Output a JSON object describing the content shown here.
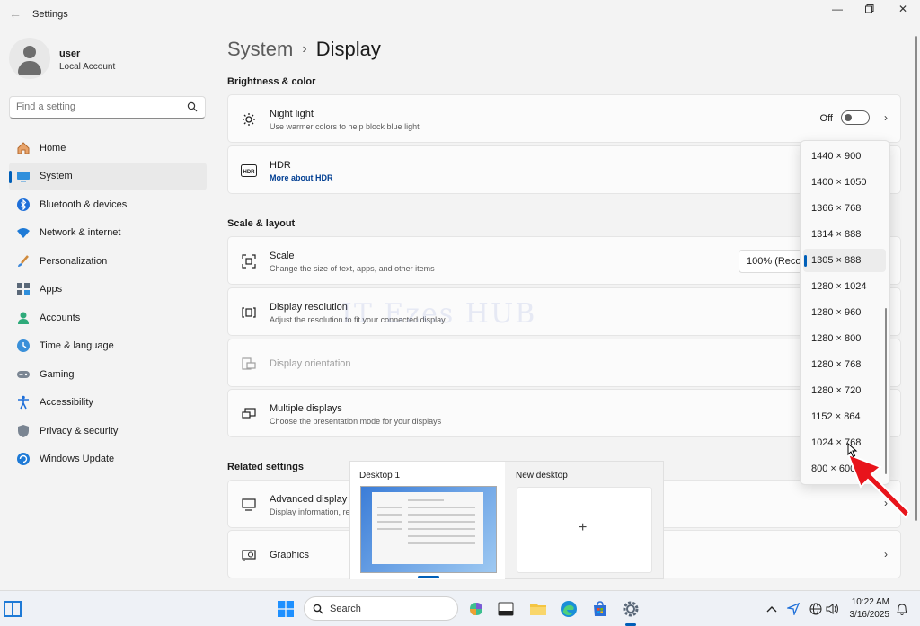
{
  "window": {
    "title": "Settings"
  },
  "profile": {
    "name": "user",
    "account_type": "Local Account"
  },
  "search": {
    "placeholder": "Find a setting"
  },
  "nav": {
    "items": [
      {
        "label": "Home"
      },
      {
        "label": "System"
      },
      {
        "label": "Bluetooth & devices"
      },
      {
        "label": "Network & internet"
      },
      {
        "label": "Personalization"
      },
      {
        "label": "Apps"
      },
      {
        "label": "Accounts"
      },
      {
        "label": "Time & language"
      },
      {
        "label": "Gaming"
      },
      {
        "label": "Accessibility"
      },
      {
        "label": "Privacy & security"
      },
      {
        "label": "Windows Update"
      }
    ],
    "selected": "System"
  },
  "breadcrumb": {
    "parent": "System",
    "current": "Display"
  },
  "sections": {
    "brightness": "Brightness & color",
    "scale": "Scale & layout",
    "related": "Related settings"
  },
  "cards": {
    "night_light": {
      "title": "Night light",
      "subtitle": "Use warmer colors to help block blue light",
      "state": "Off"
    },
    "hdr": {
      "title": "HDR",
      "link": "More about HDR"
    },
    "scale": {
      "title": "Scale",
      "subtitle": "Change the size of text, apps, and other items",
      "value": "100% (Recommended)"
    },
    "resolution": {
      "title": "Display resolution",
      "subtitle": "Adjust the resolution to fit your connected display"
    },
    "orientation": {
      "title": "Display orientation"
    },
    "multiple": {
      "title": "Multiple displays",
      "subtitle": "Choose the presentation mode for your displays"
    },
    "advanced": {
      "title": "Advanced display",
      "subtitle": "Display information, refresh rate"
    },
    "graphics": {
      "title": "Graphics"
    }
  },
  "watermark": "IT Ezes HUB",
  "resolution_options": [
    "1440 × 900",
    "1400 × 1050",
    "1366 × 768",
    "1314 × 888",
    "1305 × 888",
    "1280 × 1024",
    "1280 × 960",
    "1280 × 800",
    "1280 × 768",
    "1280 × 720",
    "1152 × 864",
    "1024 × 768",
    "800 × 600"
  ],
  "resolution_selected": "1305 × 888",
  "taskview": {
    "desktop1": "Desktop 1",
    "desktop2": "New desktop",
    "add": "+"
  },
  "taskbar": {
    "search_label": "Search",
    "time": "10:22 AM",
    "date": "3/16/2025"
  },
  "colors": {
    "accent": "#005fb8",
    "arrow": "#e8141b"
  }
}
